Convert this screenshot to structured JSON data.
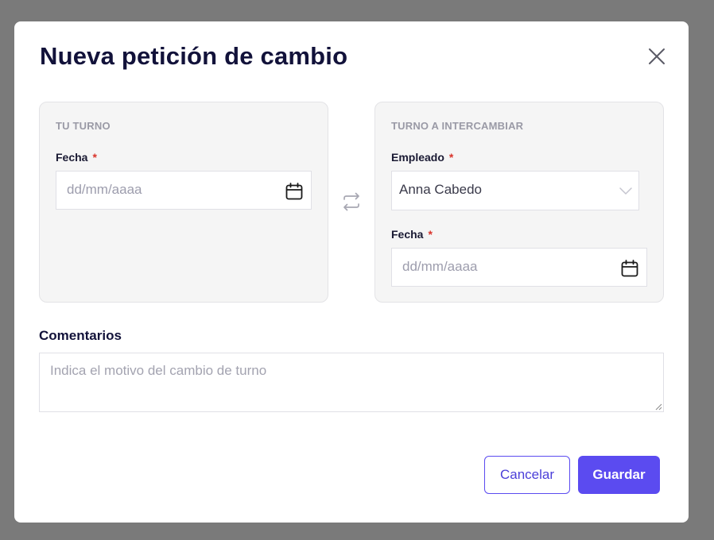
{
  "modal": {
    "title": "Nueva petición de cambio"
  },
  "my_shift": {
    "heading": "TU TURNO",
    "date_label": "Fecha",
    "required_mark": "*",
    "date_placeholder": "dd/mm/aaaa"
  },
  "swap_shift": {
    "heading": "TURNO A INTERCAMBIAR",
    "employee_label": "Empleado",
    "employee_value": "Anna Cabedo",
    "date_label": "Fecha",
    "required_mark": "*",
    "date_placeholder": "dd/mm/aaaa"
  },
  "comments": {
    "label": "Comentarios",
    "placeholder": "Indica el motivo del cambio de turno"
  },
  "actions": {
    "cancel_label": "Cancelar",
    "save_label": "Guardar"
  },
  "icons": {
    "close": "close-icon",
    "calendar": "calendar-icon",
    "swap": "swap-arrows-icon",
    "chevron": "chevron-down-icon"
  },
  "colors": {
    "accent": "#5b4bf0",
    "required": "#d9342b",
    "overlay": "#7a7a7a",
    "panel_bg": "#f5f5f5"
  }
}
